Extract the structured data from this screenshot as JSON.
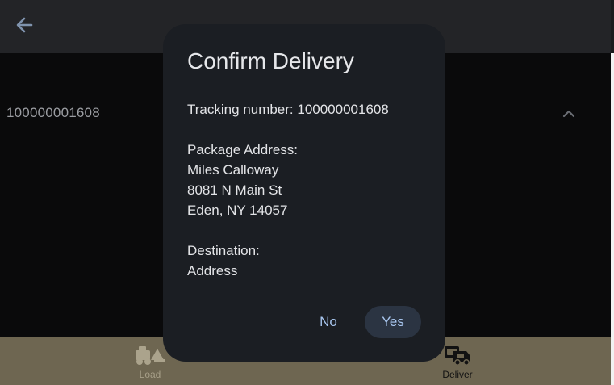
{
  "app": {
    "back_icon": "arrow-left-icon",
    "background_tracking": "100000001608",
    "expand_icon": "chevron-up-icon"
  },
  "dialog": {
    "title": "Confirm Delivery",
    "tracking_line": "Tracking number: 100000001608",
    "package_address_label": "Package Address:",
    "address_name": "Miles Calloway",
    "address_street": "8081 N Main St",
    "address_city": "Eden, NY 14057",
    "destination_label": "Destination:",
    "destination_value": "Address",
    "no_label": "No",
    "yes_label": "Yes"
  },
  "bottom_nav": {
    "items": [
      {
        "label": "Load",
        "icon": "forklift-icon",
        "active": false
      },
      {
        "label": "Deliver",
        "icon": "delivery-truck-icon",
        "active": true
      }
    ]
  },
  "colors": {
    "accent": "#a8c6ef",
    "topbar": "#232427",
    "dialog": "#1b1e23",
    "nav": "#6e6651"
  }
}
